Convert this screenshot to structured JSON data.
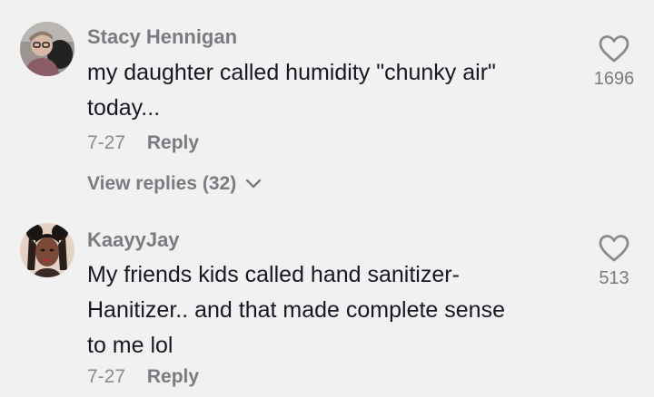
{
  "comments": [
    {
      "username": "Stacy Hennigan",
      "text_lines": [
        "my daughter called humidity \"chunky air\"",
        "today..."
      ],
      "date": "7-27",
      "reply_label": "Reply",
      "view_replies": "View replies (32)",
      "likes": "1696",
      "avatar_icon": "avatar-woman-glasses"
    },
    {
      "username": "KaayyJay",
      "text_lines": [
        "My friends kids called hand sanitizer-",
        "Hanitizer.. and that made complete sense",
        "to me lol"
      ],
      "date": "7-27",
      "reply_label": "Reply",
      "likes": "513",
      "avatar_icon": "avatar-woman-braids"
    }
  ],
  "icons": {
    "like": "heart-outline-icon",
    "expand": "chevron-down-icon"
  },
  "colors": {
    "background": "#f1f1f1",
    "text": "#161823",
    "muted": "#7a7b80"
  }
}
